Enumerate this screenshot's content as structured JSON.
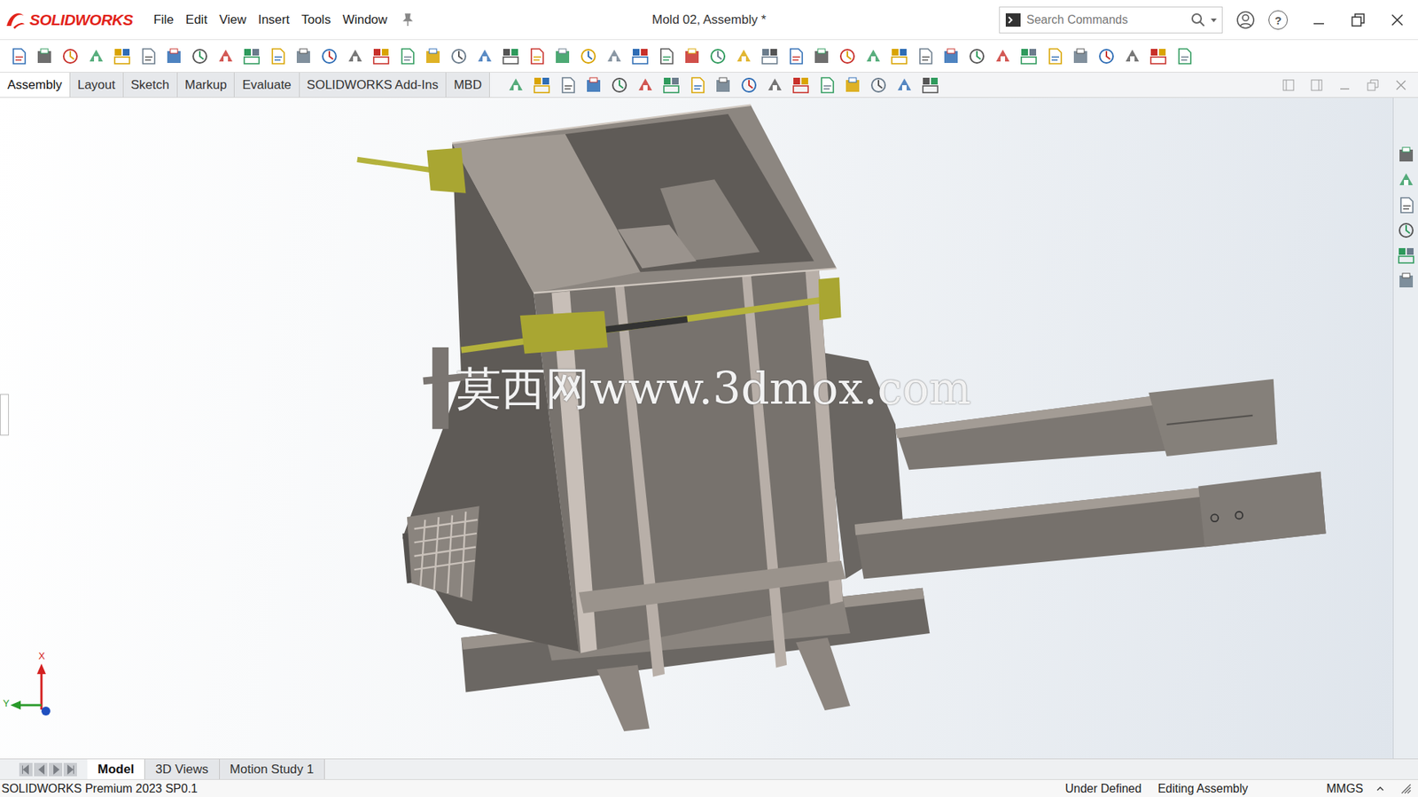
{
  "window": {
    "app": "SOLIDWORKS",
    "title": "Mold 02, Assembly *",
    "help_icon": "?"
  },
  "menu": [
    "File",
    "Edit",
    "View",
    "Insert",
    "Tools",
    "Window"
  ],
  "search": {
    "placeholder": "Search Commands"
  },
  "command_tabs": [
    {
      "label": "Assembly",
      "selected": true
    },
    {
      "label": "Layout",
      "selected": false
    },
    {
      "label": "Sketch",
      "selected": false
    },
    {
      "label": "Markup",
      "selected": false
    },
    {
      "label": "Evaluate",
      "selected": false
    },
    {
      "label": "SOLIDWORKS Add-Ins",
      "selected": false
    },
    {
      "label": "MBD",
      "selected": false
    }
  ],
  "viewport": {
    "watermark": "莫西网www.3dmox.com",
    "triad": {
      "x": "X",
      "y": "Y"
    }
  },
  "bottom_tabs": [
    {
      "label": "Model",
      "selected": true
    },
    {
      "label": "3D Views",
      "selected": false
    },
    {
      "label": "Motion Study 1",
      "selected": false
    }
  ],
  "status_bar": {
    "product": "SOLIDWORKS Premium 2023 SP0.1",
    "definition": "Under Defined",
    "mode": "Editing Assembly",
    "units": "MMGS"
  }
}
